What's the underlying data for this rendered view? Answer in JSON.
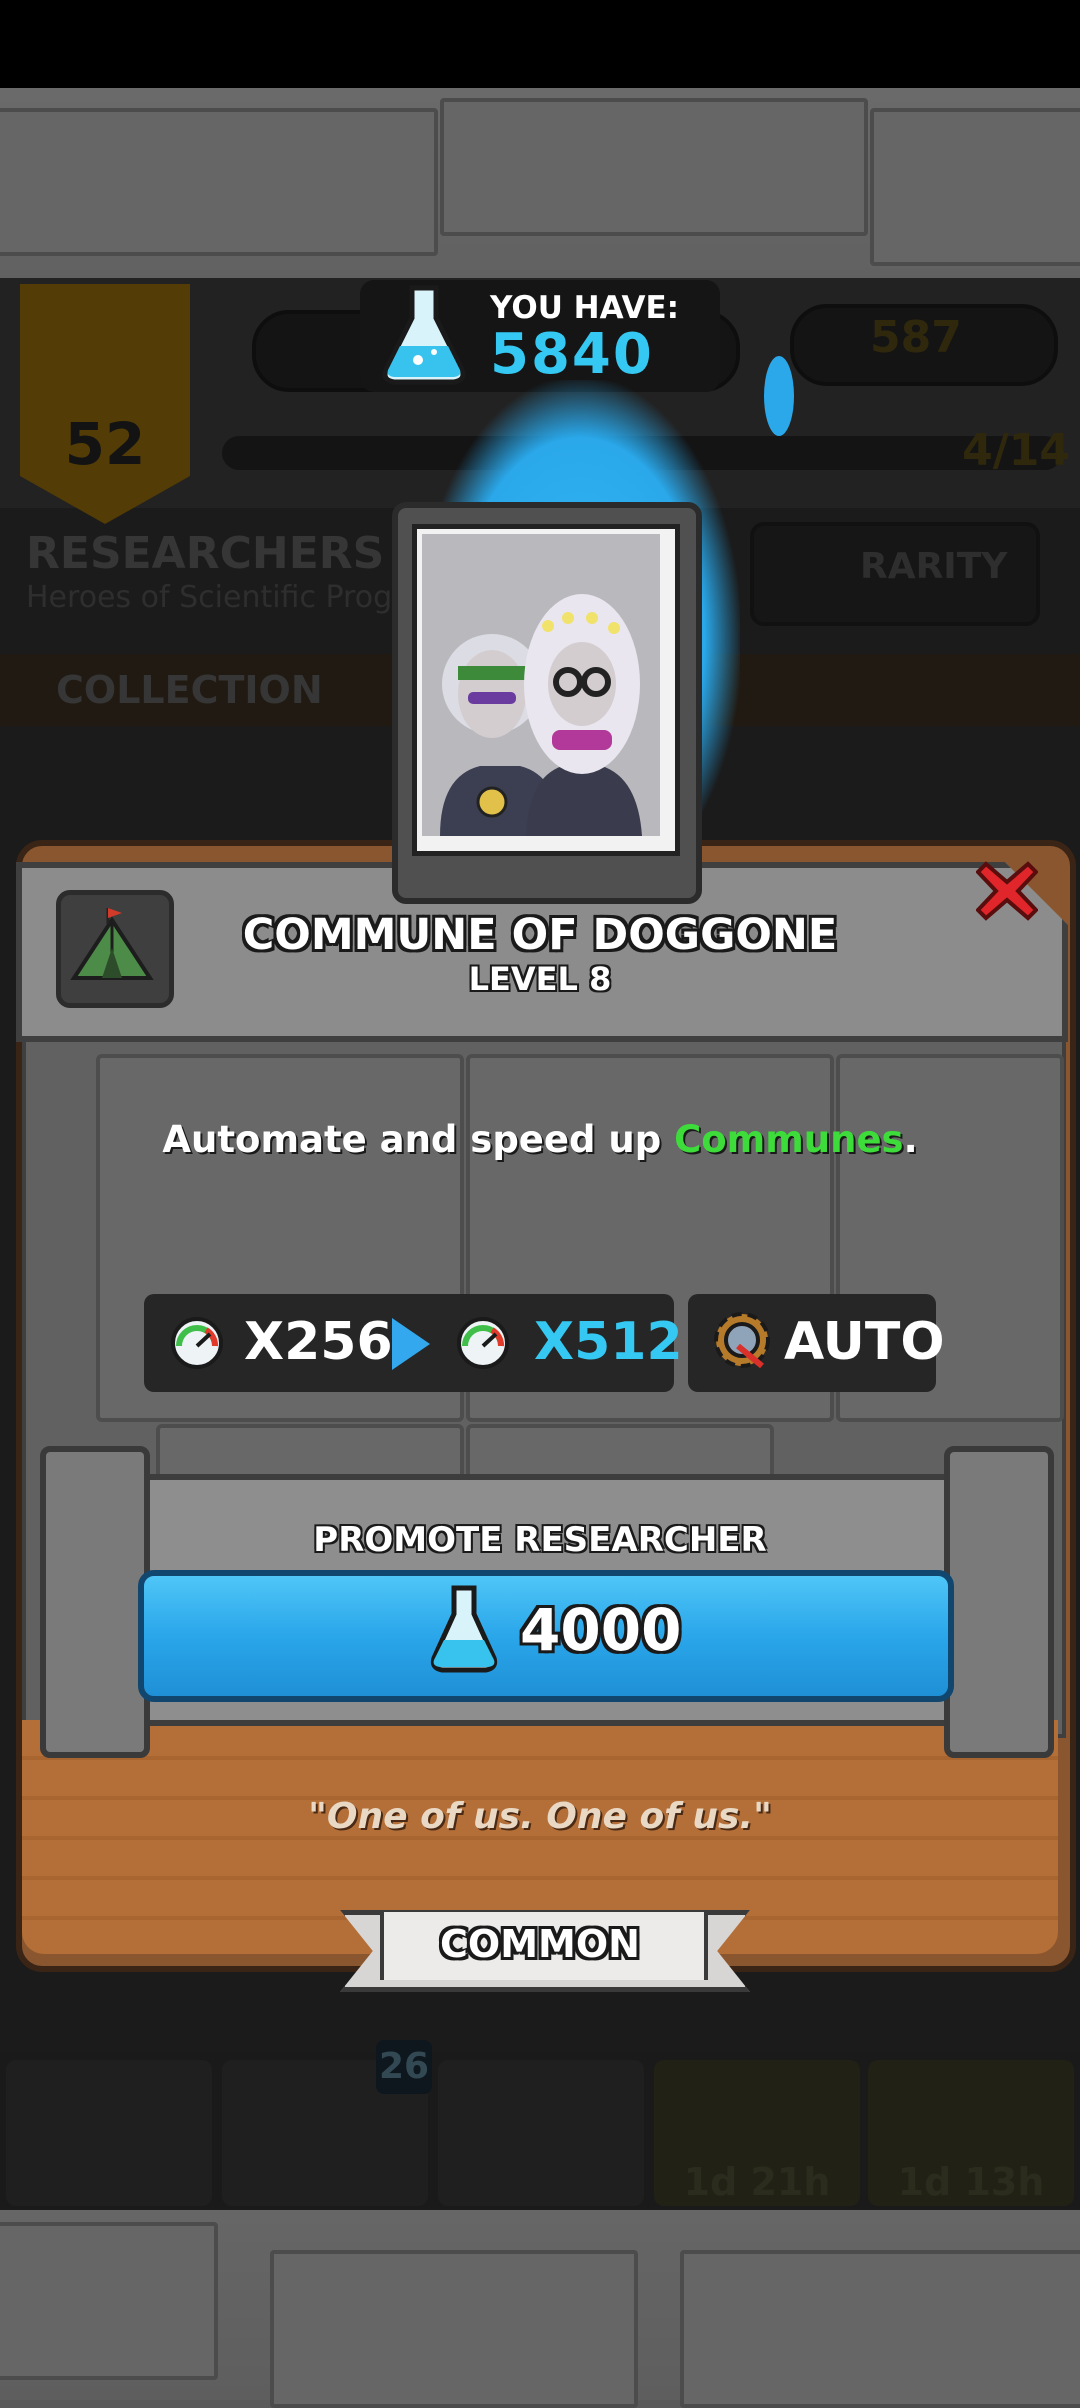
{
  "background_hud": {
    "level_badge": "52",
    "progress": "4/14",
    "gold": "587",
    "section_title": "RESEARCHERS",
    "section_subtitle": "Heroes of Scientific Prog",
    "rarity_filter": "RARITY",
    "collection_tab": "COLLECTION",
    "nav_cards_badge": "26",
    "nav_timer_1": "1d 21h",
    "nav_timer_2": "1d 13h"
  },
  "currency": {
    "label": "YOU HAVE:",
    "value": "5840"
  },
  "researcher": {
    "name": "COMMUNE OF DOGGONE",
    "level": "LEVEL 8",
    "description_prefix": "Automate and speed up ",
    "description_highlight": "Communes",
    "description_suffix": ".",
    "speed_from": "X256",
    "speed_to": "X512",
    "auto_label": "AUTO",
    "quote": "\"One of us. One of us.\"",
    "rarity": "COMMON"
  },
  "promote": {
    "label": "PROMOTE RESEARCHER",
    "cost": "4000"
  },
  "colors": {
    "accent_blue": "#34c8f2",
    "highlight_green": "#3ddc3a",
    "close_red": "#e0262a"
  }
}
